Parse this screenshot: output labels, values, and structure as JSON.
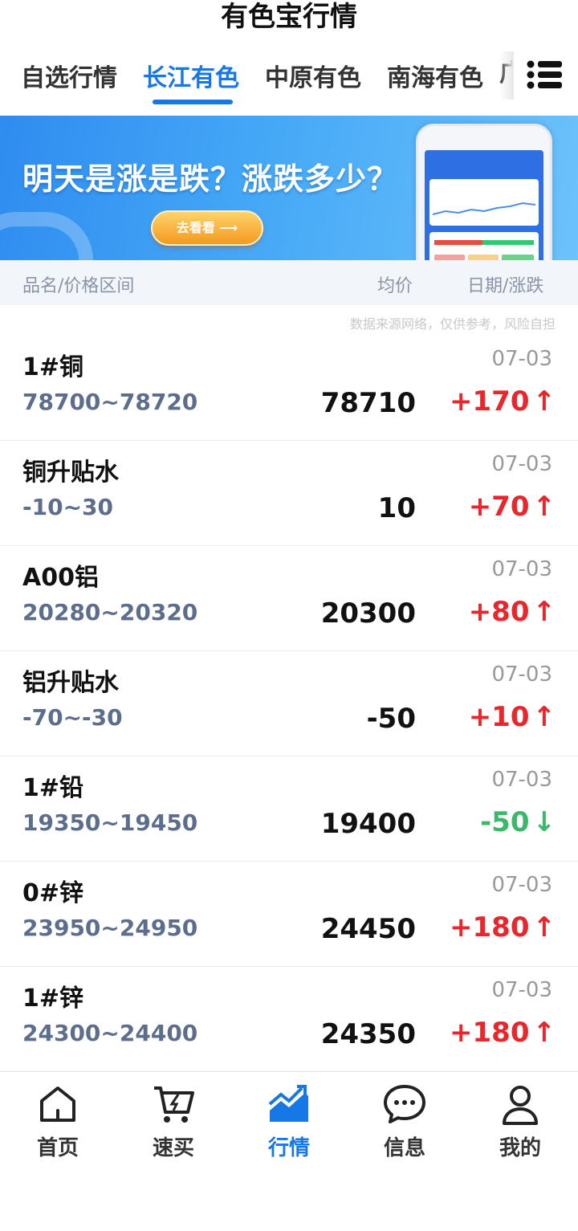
{
  "header": {
    "title": "有色宝行情"
  },
  "tabs": [
    {
      "label": "自选行情"
    },
    {
      "label": "长江有色"
    },
    {
      "label": "中原有色"
    },
    {
      "label": "南海有色"
    },
    {
      "label": "广"
    }
  ],
  "banner": {
    "headline": "明天是涨是跌？涨跌多少？",
    "button_label": "去看看 ⟶"
  },
  "table_header": {
    "name_col": "品名/价格区间",
    "avg_col": "均价",
    "date_col": "日期/涨跌"
  },
  "source_note": "数据来源网络，仅供参考，风险自担",
  "rows": [
    {
      "name": "1#铜",
      "range": "78700~78720",
      "date": "07-03",
      "avg": "78710",
      "change": "+170",
      "dir": "up"
    },
    {
      "name": "铜升贴水",
      "range": "-10~30",
      "date": "07-03",
      "avg": "10",
      "change": "+70",
      "dir": "up"
    },
    {
      "name": "A00铝",
      "range": "20280~20320",
      "date": "07-03",
      "avg": "20300",
      "change": "+80",
      "dir": "up"
    },
    {
      "name": "铝升贴水",
      "range": "-70~-30",
      "date": "07-03",
      "avg": "-50",
      "change": "+10",
      "dir": "up"
    },
    {
      "name": "1#铅",
      "range": "19350~19450",
      "date": "07-03",
      "avg": "19400",
      "change": "-50",
      "dir": "down"
    },
    {
      "name": "0#锌",
      "range": "23950~24950",
      "date": "07-03",
      "avg": "24450",
      "change": "+180",
      "dir": "up"
    },
    {
      "name": "1#锌",
      "range": "24300~24400",
      "date": "07-03",
      "avg": "24350",
      "change": "+180",
      "dir": "up"
    }
  ],
  "tabbar": [
    {
      "label": "首页",
      "icon": "home-icon"
    },
    {
      "label": "速买",
      "icon": "cart-icon"
    },
    {
      "label": "行情",
      "icon": "chart-icon"
    },
    {
      "label": "信息",
      "icon": "message-icon"
    },
    {
      "label": "我的",
      "icon": "user-icon"
    }
  ],
  "colors": {
    "accent": "#1677e6",
    "up": "#e8262b",
    "down": "#3cb86a",
    "range_text": "#5d6e8c"
  }
}
